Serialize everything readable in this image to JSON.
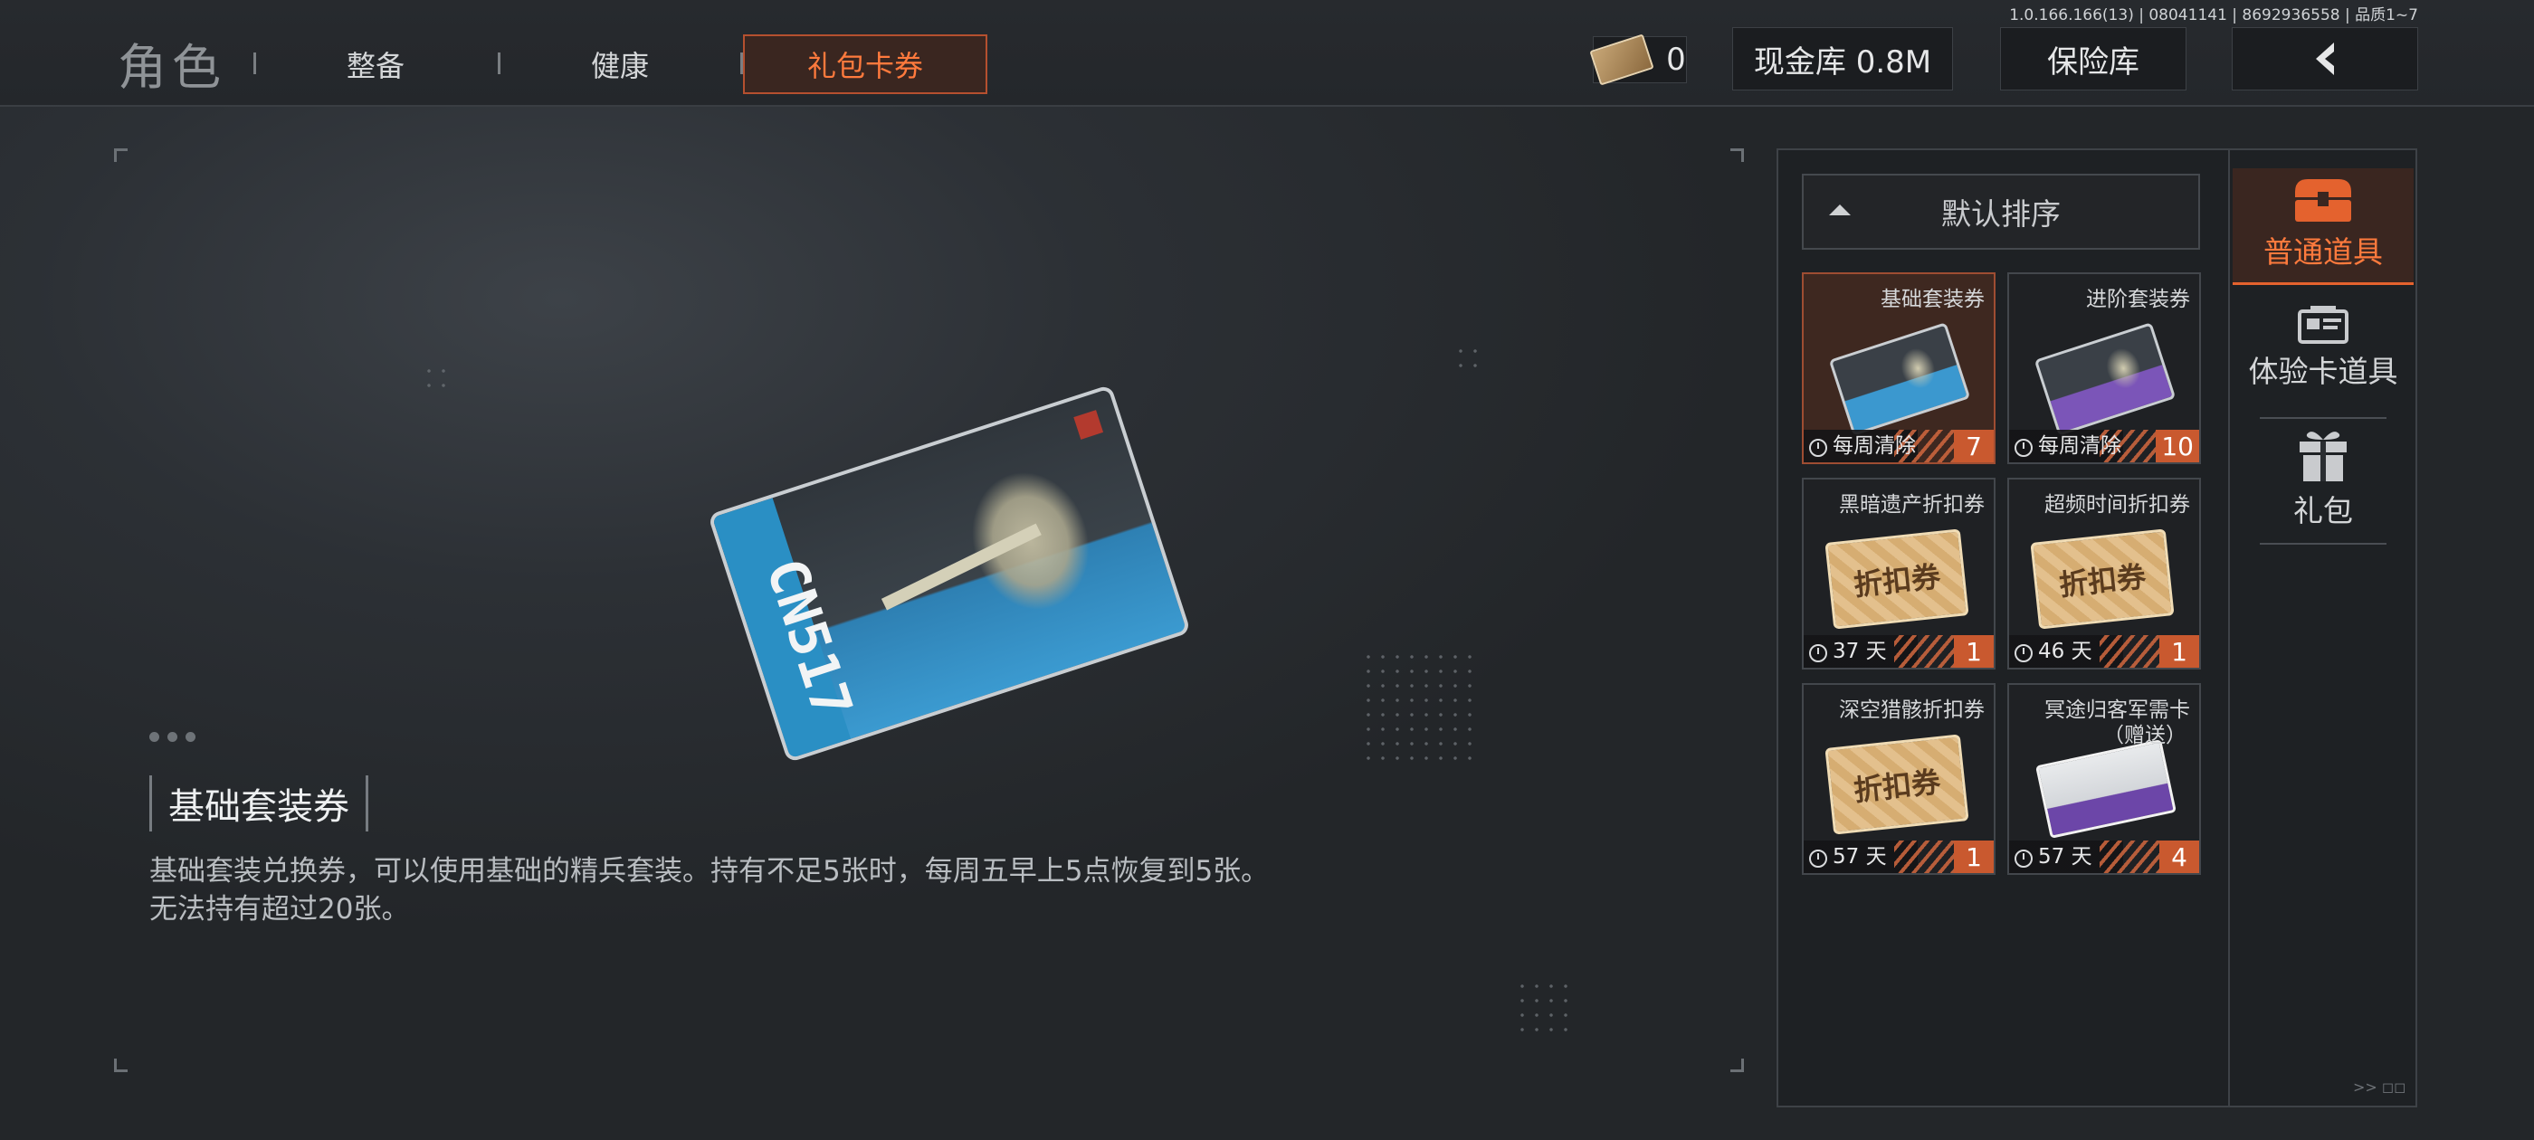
{
  "version": "1.0.166.166(13) | 08041141 | 8692936558 | 品质1~7",
  "tabs": {
    "role": "角色",
    "items": [
      {
        "label": "整备"
      },
      {
        "label": "健康"
      },
      {
        "label": "礼包卡券"
      }
    ],
    "active_index": 2
  },
  "toolbar": {
    "ticket_count": "0",
    "cash_vault": "现金库 0.8M",
    "safe_vault": "保险库",
    "back_icon": "chevron-left-icon"
  },
  "detail": {
    "title": "基础套装券",
    "description": "基础套装兑换券，可以使用基础的精兵套装。持有不足5张时，每周五早上5点恢复到5张。无法持有超过20张。",
    "card_code": "CN517"
  },
  "inventory": {
    "sort_label": "默认排序",
    "items": [
      {
        "name": "基础套装券",
        "expire": "每周清除",
        "count": "7",
        "art": "blue-card",
        "selected": true
      },
      {
        "name": "进阶套装券",
        "expire": "每周清除",
        "count": "10",
        "art": "purple-card",
        "selected": false
      },
      {
        "name": "黑暗遗产折扣券",
        "expire": "37 天",
        "count": "1",
        "art": "coupon",
        "selected": false
      },
      {
        "name": "超频时间折扣券",
        "expire": "46 天",
        "count": "1",
        "art": "coupon",
        "selected": false
      },
      {
        "name": "深空猎骸折扣券",
        "expire": "57 天",
        "count": "1",
        "art": "coupon",
        "selected": false
      },
      {
        "name": "冥途归客军需卡",
        "sub": "（赠送）",
        "expire": "57 天",
        "count": "4",
        "art": "gift-card",
        "selected": false
      }
    ],
    "coupon_text": "折扣券"
  },
  "categories": [
    {
      "label": "普通道具",
      "icon": "treasure-chest-icon",
      "active": true
    },
    {
      "label": "体验卡道具",
      "icon": "id-card-icon",
      "active": false
    },
    {
      "label": "礼包",
      "icon": "gift-icon",
      "active": false
    }
  ],
  "colors": {
    "accent": "#ff7a3d",
    "count_badge": "#c9592f",
    "background": "#2c3035"
  }
}
